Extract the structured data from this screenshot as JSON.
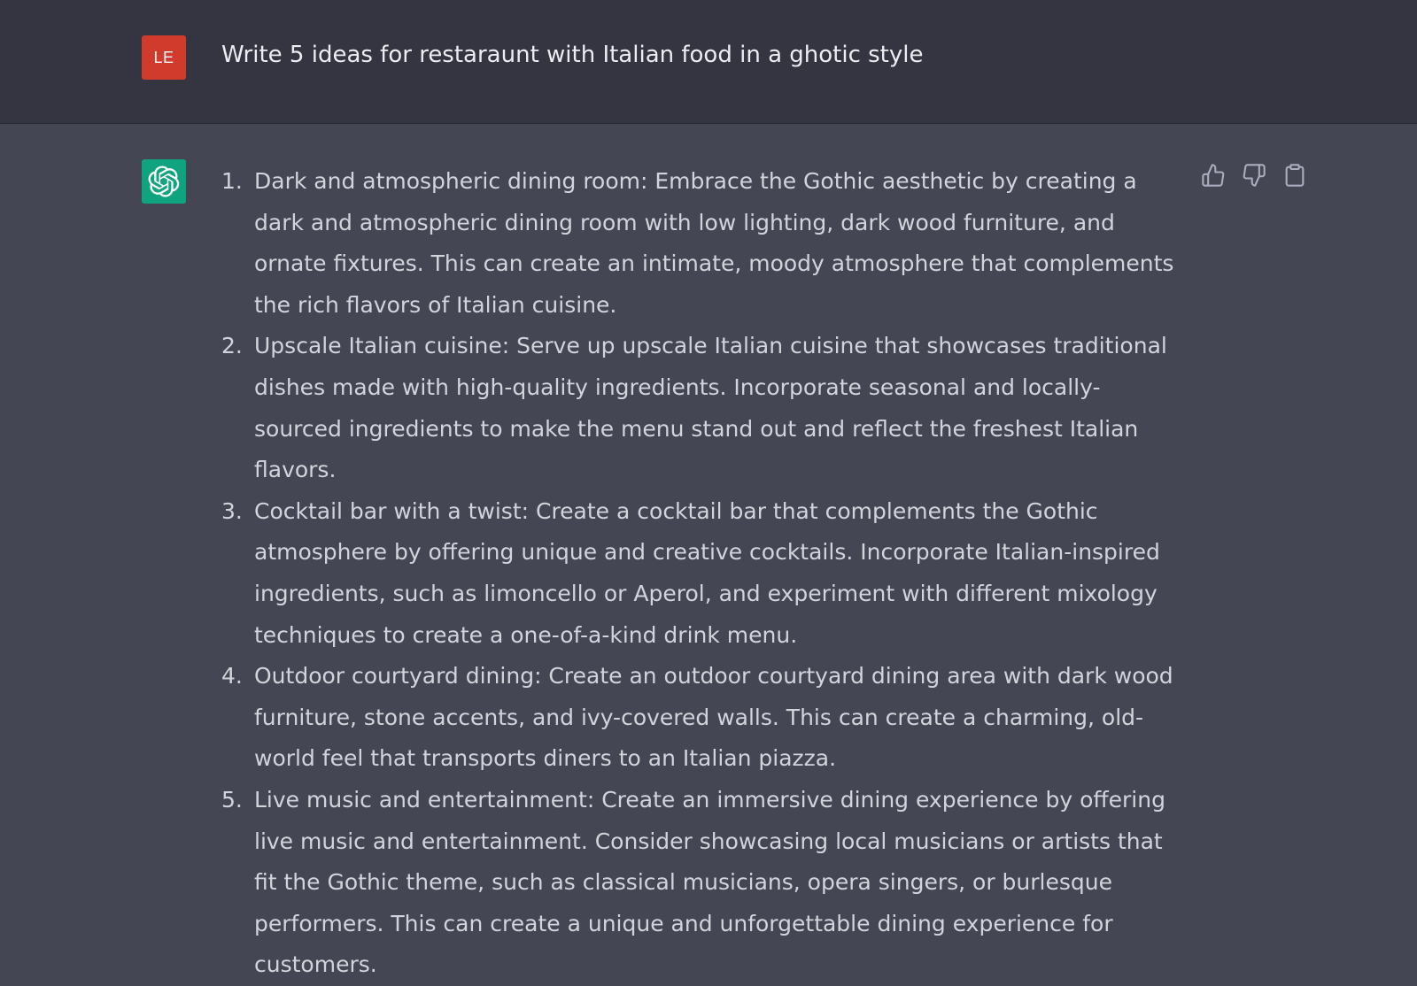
{
  "colors": {
    "user_row_bg": "#343541",
    "assistant_row_bg": "#444654",
    "user_avatar_bg": "#d13b2c",
    "bot_avatar_bg": "#10a37f",
    "text_primary": "#ececf1",
    "text_secondary": "#d1d5db",
    "icon_color": "#acacbe"
  },
  "user_message": {
    "avatar_initials": "LE",
    "text": "Write 5 ideas for restaraunt with Italian food in a ghotic style"
  },
  "assistant_message": {
    "avatar_icon": "openai-logo-icon",
    "items": [
      {
        "number": "1.",
        "text": "Dark and atmospheric dining room: Embrace the Gothic aesthetic by creating a dark and atmospheric dining room with low lighting, dark wood furniture, and ornate fixtures. This can create an intimate, moody atmosphere that complements the rich flavors of Italian cuisine."
      },
      {
        "number": "2.",
        "text": "Upscale Italian cuisine: Serve up upscale Italian cuisine that showcases traditional dishes made with high-quality ingredients. Incorporate seasonal and locally-sourced ingredients to make the menu stand out and reflect the freshest Italian flavors."
      },
      {
        "number": "3.",
        "text": "Cocktail bar with a twist: Create a cocktail bar that complements the Gothic atmosphere by offering unique and creative cocktails. Incorporate Italian-inspired ingredients, such as limoncello or Aperol, and experiment with different mixology techniques to create a one-of-a-kind drink menu."
      },
      {
        "number": "4.",
        "text": "Outdoor courtyard dining: Create an outdoor courtyard dining area with dark wood furniture, stone accents, and ivy-covered walls. This can create a charming, old-world feel that transports diners to an Italian piazza."
      },
      {
        "number": "5.",
        "text": "Live music and entertainment: Create an immersive dining experience by offering live music and entertainment. Consider showcasing local musicians or artists that fit the Gothic theme, such as classical musicians, opera singers, or burlesque performers. This can create a unique and unforgettable dining experience for customers."
      }
    ],
    "actions": [
      {
        "icon": "thumbs-up-icon"
      },
      {
        "icon": "thumbs-down-icon"
      },
      {
        "icon": "clipboard-icon"
      }
    ]
  }
}
